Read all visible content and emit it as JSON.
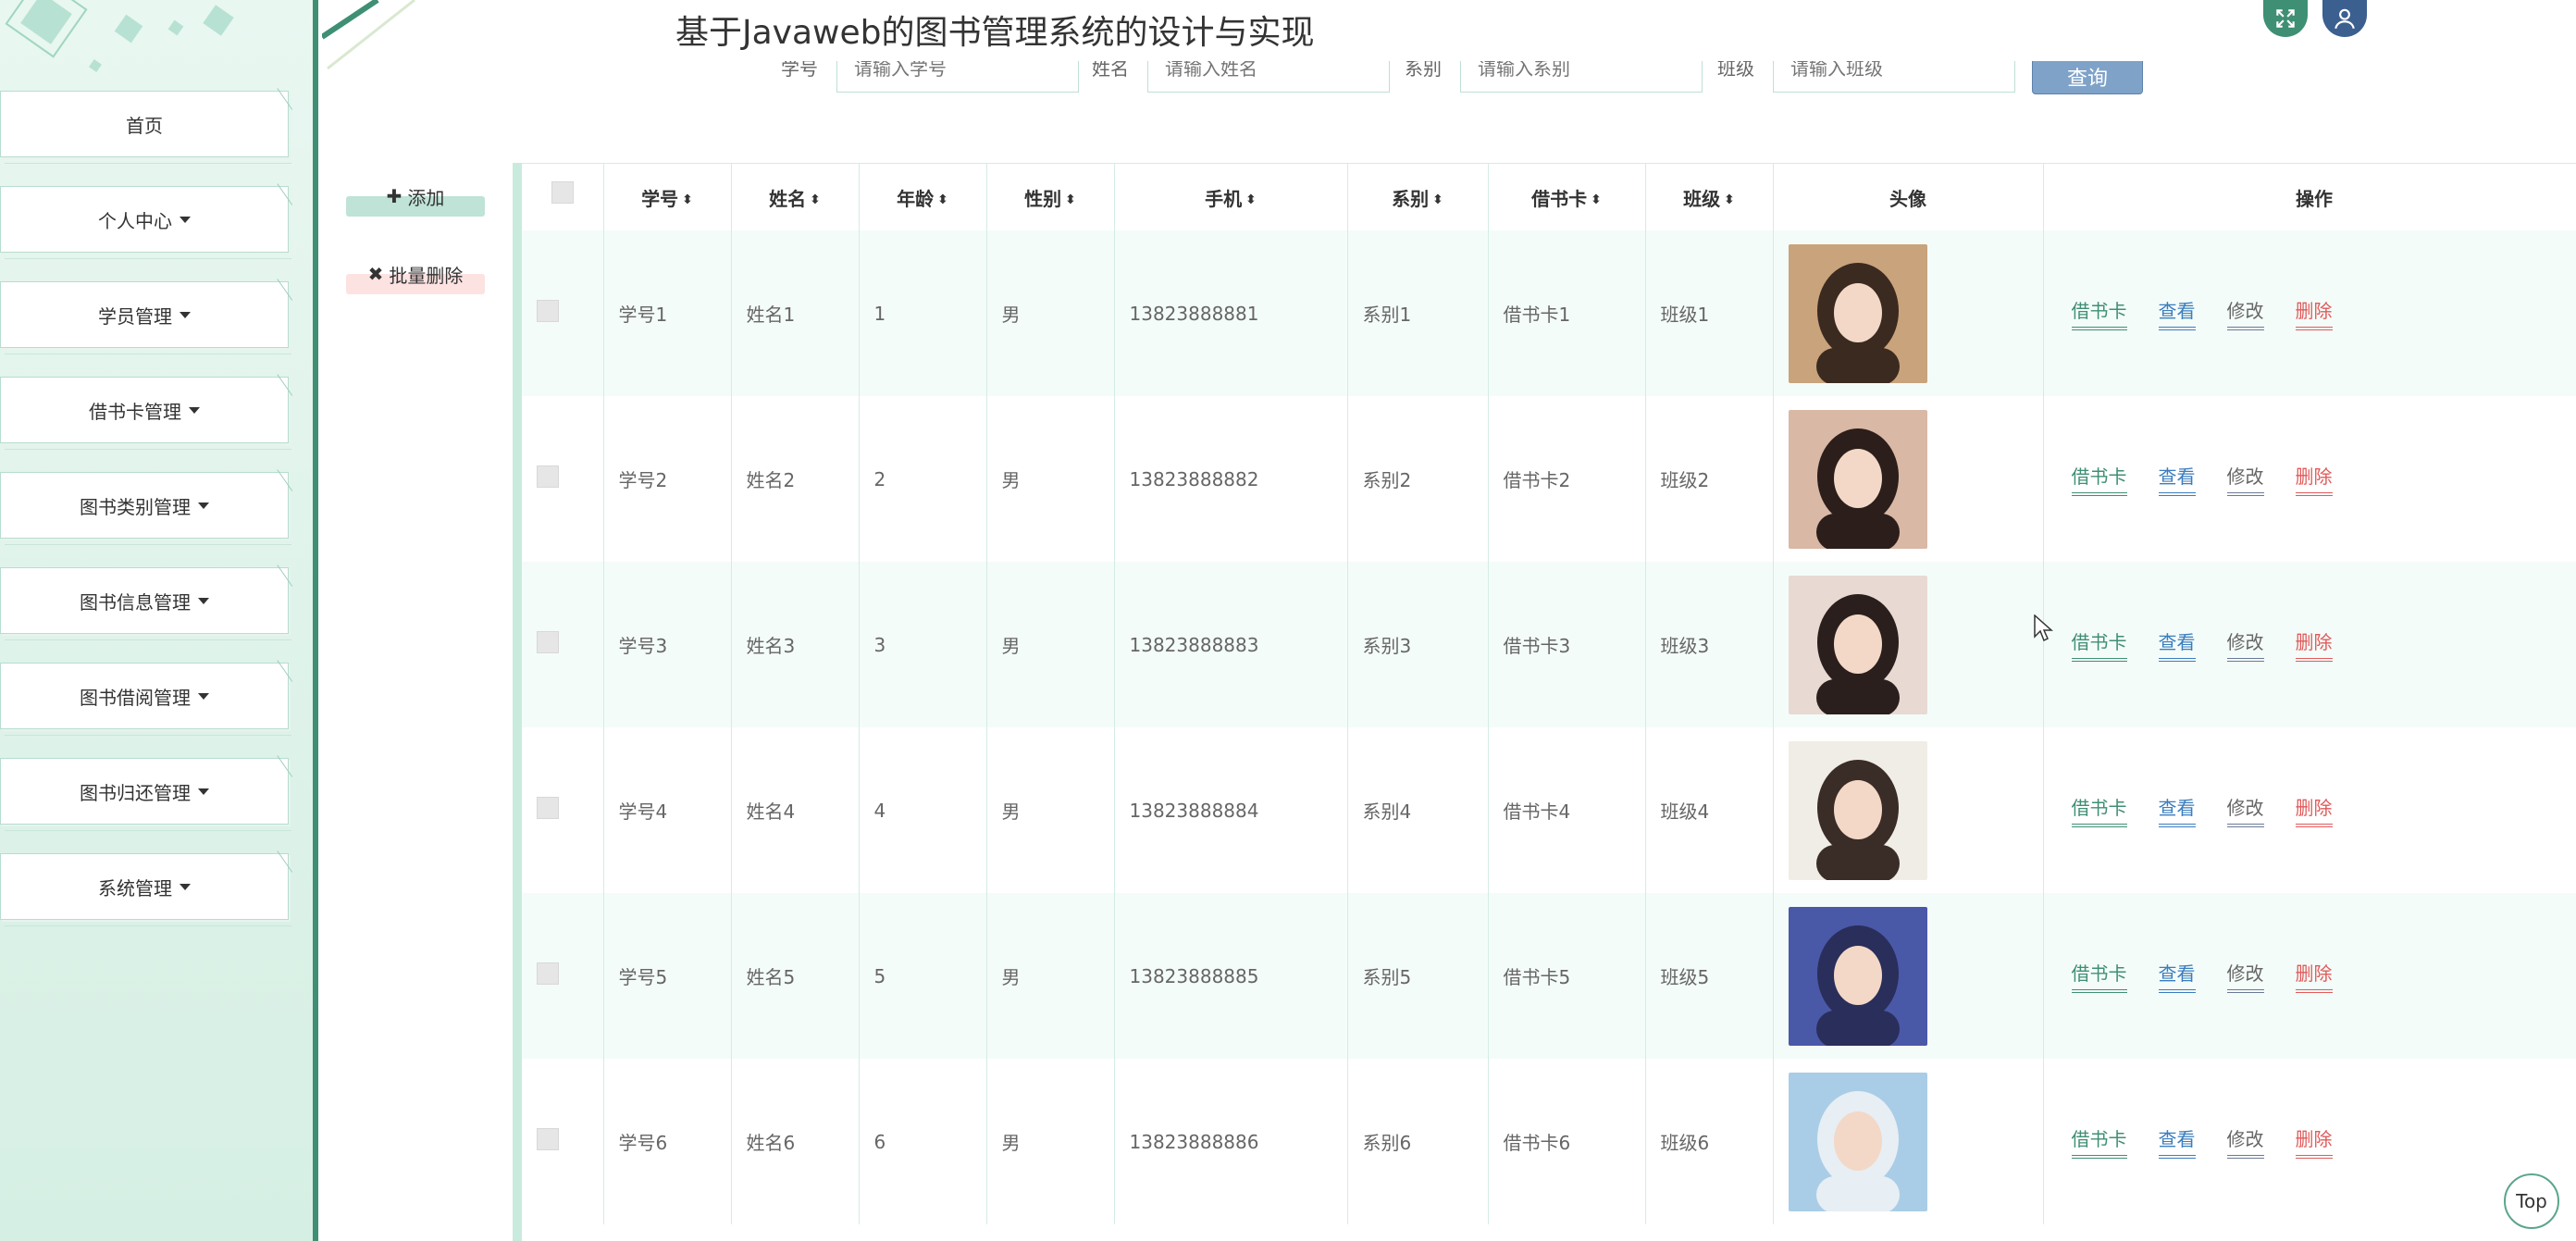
{
  "header": {
    "title": "基于Javaweb的图书管理系统的设计与实现"
  },
  "top_icons": [
    {
      "name": "fullscreen-icon",
      "color": "#3f8f74"
    },
    {
      "name": "user-icon",
      "color": "#3b5f8f"
    }
  ],
  "search": {
    "fields": [
      {
        "label": "学号",
        "placeholder": "请输入学号"
      },
      {
        "label": "姓名",
        "placeholder": "请输入姓名"
      },
      {
        "label": "系别",
        "placeholder": "请输入系别"
      },
      {
        "label": "班级",
        "placeholder": "请输入班级"
      }
    ],
    "button_label": "查询"
  },
  "sidebar": {
    "items": [
      {
        "label": "首页",
        "has_caret": false
      },
      {
        "label": "个人中心",
        "has_caret": true
      },
      {
        "label": "学员管理",
        "has_caret": true
      },
      {
        "label": "借书卡管理",
        "has_caret": true
      },
      {
        "label": "图书类别管理",
        "has_caret": true
      },
      {
        "label": "图书信息管理",
        "has_caret": true
      },
      {
        "label": "图书借阅管理",
        "has_caret": true
      },
      {
        "label": "图书归还管理",
        "has_caret": true
      },
      {
        "label": "系统管理",
        "has_caret": true
      }
    ]
  },
  "actions": {
    "add_label": "添加",
    "batch_delete_label": "批量删除"
  },
  "table": {
    "columns": [
      "学号",
      "姓名",
      "年龄",
      "性别",
      "手机",
      "系别",
      "借书卡",
      "班级",
      "头像",
      "操作"
    ],
    "rows": [
      {
        "id": "学号1",
        "name": "姓名1",
        "age": "1",
        "gender": "男",
        "phone": "13823888881",
        "dept": "系别1",
        "card": "借书卡1",
        "class": "班级1"
      },
      {
        "id": "学号2",
        "name": "姓名2",
        "age": "2",
        "gender": "男",
        "phone": "13823888882",
        "dept": "系别2",
        "card": "借书卡2",
        "class": "班级2"
      },
      {
        "id": "学号3",
        "name": "姓名3",
        "age": "3",
        "gender": "男",
        "phone": "13823888883",
        "dept": "系别3",
        "card": "借书卡3",
        "class": "班级3"
      },
      {
        "id": "学号4",
        "name": "姓名4",
        "age": "4",
        "gender": "男",
        "phone": "13823888884",
        "dept": "系别4",
        "card": "借书卡4",
        "class": "班级4"
      },
      {
        "id": "学号5",
        "name": "姓名5",
        "age": "5",
        "gender": "男",
        "phone": "13823888885",
        "dept": "系别5",
        "card": "借书卡5",
        "class": "班级5"
      },
      {
        "id": "学号6",
        "name": "姓名6",
        "age": "6",
        "gender": "男",
        "phone": "13823888886",
        "dept": "系别6",
        "card": "借书卡6",
        "class": "班级6"
      }
    ],
    "operations": [
      "借书卡",
      "查看",
      "修改",
      "删除"
    ]
  },
  "avatar_colors": [
    [
      "#c9a37c",
      "#3b2a20"
    ],
    [
      "#d9b8a6",
      "#2c1e1a"
    ],
    [
      "#e8d9d3",
      "#2a1f1c"
    ],
    [
      "#f0ede6",
      "#3a2c26"
    ],
    [
      "#4a58a8",
      "#2a2e5a"
    ],
    [
      "#a9cde6",
      "#e7eef4"
    ]
  ],
  "scroll_top_label": "Top"
}
